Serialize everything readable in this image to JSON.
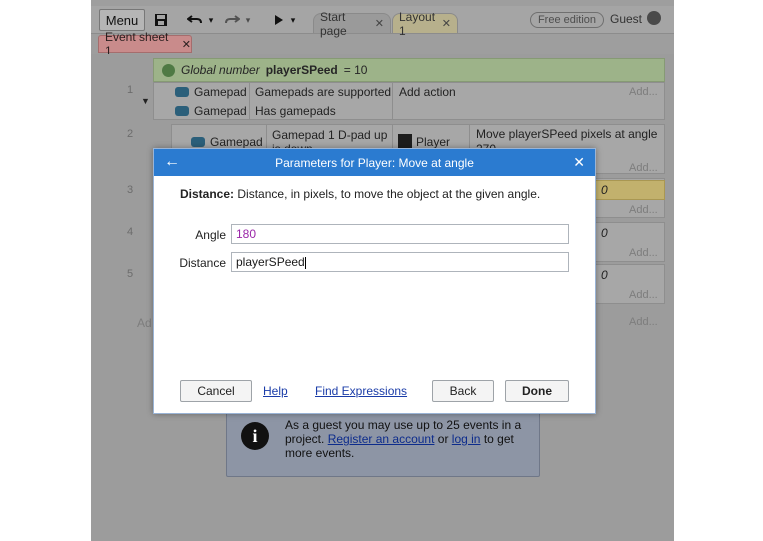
{
  "toolbar": {
    "menu_label": "Menu",
    "tabs": [
      {
        "label": "Start page"
      },
      {
        "label": "Layout 1"
      }
    ],
    "edition_label": "Free edition",
    "user_label": "Guest"
  },
  "sheet_tab": {
    "label": "Event sheet 1"
  },
  "events": {
    "global": {
      "prefix": "Global number",
      "name": "playerSPeed",
      "value_text": "= 10"
    },
    "rows": [
      {
        "number": "1",
        "conditions": [
          {
            "object": "Gamepad",
            "text": "Gamepads are supported"
          },
          {
            "object": "Gamepad",
            "text": "Has gamepads"
          }
        ],
        "action_text": "Add action",
        "add_text": "Add..."
      },
      {
        "number": "2",
        "condition_object": "Gamepad",
        "condition_text": "Gamepad 1 D-pad up",
        "condition_text_cut": "is down",
        "action_object": "Player",
        "action_text": "Move playerSPeed pixels at angle",
        "action_text_cut": "270",
        "add_text": "Add..."
      },
      {
        "number": "3",
        "action_value": "0",
        "add_text": "Add..."
      },
      {
        "number": "4",
        "action_value": "0",
        "add_text": "Add..."
      },
      {
        "number": "5",
        "action_value": "0",
        "add_text": "Add..."
      }
    ],
    "add_event_partial": "Ad",
    "add_bottom": "Add..."
  },
  "info_box": {
    "text_before": "As a guest you may use up to 25 events in a project.",
    "register_link": "Register an account",
    "middle": "or",
    "login_link": "log in",
    "text_after": "to get more events."
  },
  "dialog": {
    "title": "Parameters for Player: Move at angle",
    "description_label": "Distance:",
    "description_text": "Distance, in pixels, to move the object at the given angle.",
    "fields": [
      {
        "label": "Angle",
        "value": "180"
      },
      {
        "label": "Distance",
        "value": "playerSPeed"
      }
    ],
    "buttons": {
      "cancel": "Cancel",
      "help": "Help",
      "find_expressions": "Find Expressions",
      "back": "Back",
      "done": "Done"
    }
  },
  "colors": {
    "dialog_title_bg": "#2b7bd0",
    "angle_value": "#9a27a8",
    "link": "#1a3ca8"
  }
}
